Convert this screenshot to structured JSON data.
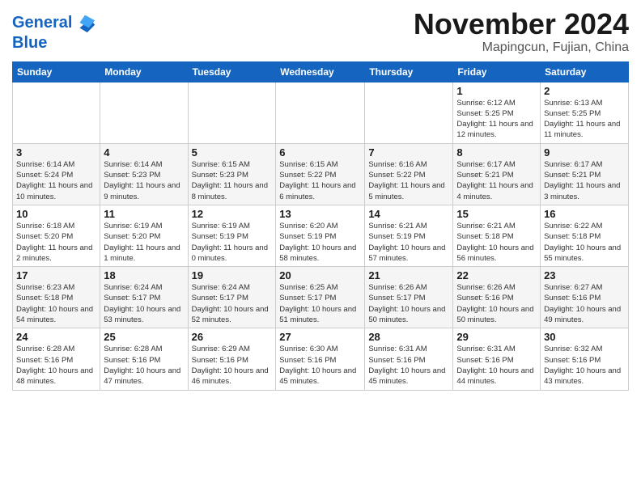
{
  "header": {
    "logo_line1": "General",
    "logo_line2": "Blue",
    "month": "November 2024",
    "location": "Mapingcun, Fujian, China"
  },
  "weekdays": [
    "Sunday",
    "Monday",
    "Tuesday",
    "Wednesday",
    "Thursday",
    "Friday",
    "Saturday"
  ],
  "weeks": [
    [
      {
        "day": "",
        "info": ""
      },
      {
        "day": "",
        "info": ""
      },
      {
        "day": "",
        "info": ""
      },
      {
        "day": "",
        "info": ""
      },
      {
        "day": "",
        "info": ""
      },
      {
        "day": "1",
        "info": "Sunrise: 6:12 AM\nSunset: 5:25 PM\nDaylight: 11 hours\nand 12 minutes."
      },
      {
        "day": "2",
        "info": "Sunrise: 6:13 AM\nSunset: 5:25 PM\nDaylight: 11 hours\nand 11 minutes."
      }
    ],
    [
      {
        "day": "3",
        "info": "Sunrise: 6:14 AM\nSunset: 5:24 PM\nDaylight: 11 hours\nand 10 minutes."
      },
      {
        "day": "4",
        "info": "Sunrise: 6:14 AM\nSunset: 5:23 PM\nDaylight: 11 hours\nand 9 minutes."
      },
      {
        "day": "5",
        "info": "Sunrise: 6:15 AM\nSunset: 5:23 PM\nDaylight: 11 hours\nand 8 minutes."
      },
      {
        "day": "6",
        "info": "Sunrise: 6:15 AM\nSunset: 5:22 PM\nDaylight: 11 hours\nand 6 minutes."
      },
      {
        "day": "7",
        "info": "Sunrise: 6:16 AM\nSunset: 5:22 PM\nDaylight: 11 hours\nand 5 minutes."
      },
      {
        "day": "8",
        "info": "Sunrise: 6:17 AM\nSunset: 5:21 PM\nDaylight: 11 hours\nand 4 minutes."
      },
      {
        "day": "9",
        "info": "Sunrise: 6:17 AM\nSunset: 5:21 PM\nDaylight: 11 hours\nand 3 minutes."
      }
    ],
    [
      {
        "day": "10",
        "info": "Sunrise: 6:18 AM\nSunset: 5:20 PM\nDaylight: 11 hours\nand 2 minutes."
      },
      {
        "day": "11",
        "info": "Sunrise: 6:19 AM\nSunset: 5:20 PM\nDaylight: 11 hours\nand 1 minute."
      },
      {
        "day": "12",
        "info": "Sunrise: 6:19 AM\nSunset: 5:19 PM\nDaylight: 11 hours\nand 0 minutes."
      },
      {
        "day": "13",
        "info": "Sunrise: 6:20 AM\nSunset: 5:19 PM\nDaylight: 10 hours\nand 58 minutes."
      },
      {
        "day": "14",
        "info": "Sunrise: 6:21 AM\nSunset: 5:19 PM\nDaylight: 10 hours\nand 57 minutes."
      },
      {
        "day": "15",
        "info": "Sunrise: 6:21 AM\nSunset: 5:18 PM\nDaylight: 10 hours\nand 56 minutes."
      },
      {
        "day": "16",
        "info": "Sunrise: 6:22 AM\nSunset: 5:18 PM\nDaylight: 10 hours\nand 55 minutes."
      }
    ],
    [
      {
        "day": "17",
        "info": "Sunrise: 6:23 AM\nSunset: 5:18 PM\nDaylight: 10 hours\nand 54 minutes."
      },
      {
        "day": "18",
        "info": "Sunrise: 6:24 AM\nSunset: 5:17 PM\nDaylight: 10 hours\nand 53 minutes."
      },
      {
        "day": "19",
        "info": "Sunrise: 6:24 AM\nSunset: 5:17 PM\nDaylight: 10 hours\nand 52 minutes."
      },
      {
        "day": "20",
        "info": "Sunrise: 6:25 AM\nSunset: 5:17 PM\nDaylight: 10 hours\nand 51 minutes."
      },
      {
        "day": "21",
        "info": "Sunrise: 6:26 AM\nSunset: 5:17 PM\nDaylight: 10 hours\nand 50 minutes."
      },
      {
        "day": "22",
        "info": "Sunrise: 6:26 AM\nSunset: 5:16 PM\nDaylight: 10 hours\nand 50 minutes."
      },
      {
        "day": "23",
        "info": "Sunrise: 6:27 AM\nSunset: 5:16 PM\nDaylight: 10 hours\nand 49 minutes."
      }
    ],
    [
      {
        "day": "24",
        "info": "Sunrise: 6:28 AM\nSunset: 5:16 PM\nDaylight: 10 hours\nand 48 minutes."
      },
      {
        "day": "25",
        "info": "Sunrise: 6:28 AM\nSunset: 5:16 PM\nDaylight: 10 hours\nand 47 minutes."
      },
      {
        "day": "26",
        "info": "Sunrise: 6:29 AM\nSunset: 5:16 PM\nDaylight: 10 hours\nand 46 minutes."
      },
      {
        "day": "27",
        "info": "Sunrise: 6:30 AM\nSunset: 5:16 PM\nDaylight: 10 hours\nand 45 minutes."
      },
      {
        "day": "28",
        "info": "Sunrise: 6:31 AM\nSunset: 5:16 PM\nDaylight: 10 hours\nand 45 minutes."
      },
      {
        "day": "29",
        "info": "Sunrise: 6:31 AM\nSunset: 5:16 PM\nDaylight: 10 hours\nand 44 minutes."
      },
      {
        "day": "30",
        "info": "Sunrise: 6:32 AM\nSunset: 5:16 PM\nDaylight: 10 hours\nand 43 minutes."
      }
    ]
  ]
}
